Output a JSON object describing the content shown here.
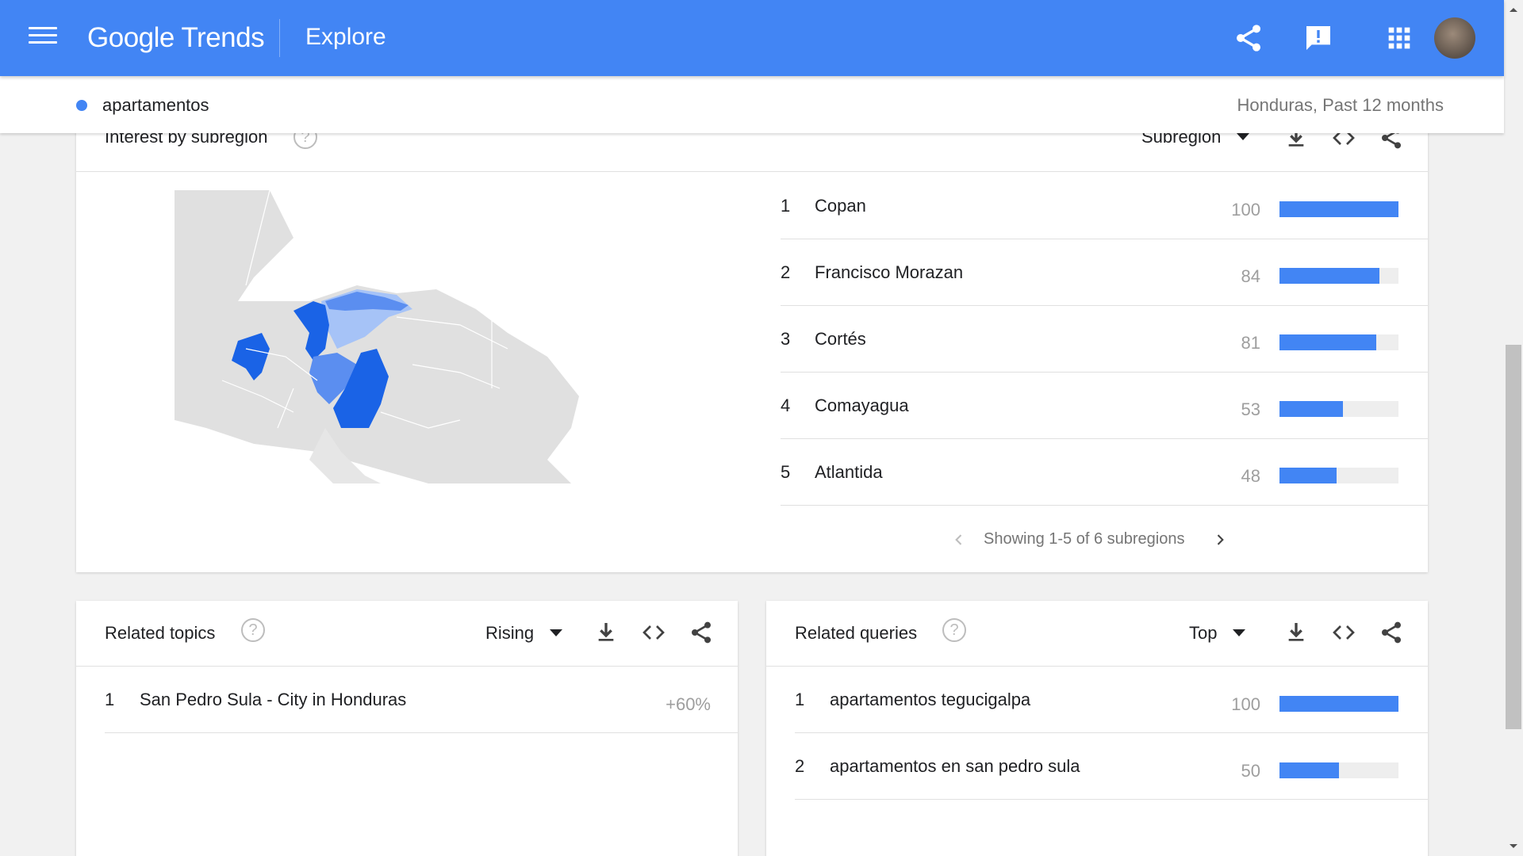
{
  "header": {
    "logo": "Google Trends",
    "section": "Explore",
    "icons": [
      "menu-icon",
      "share-icon",
      "feedback-icon",
      "apps-icon",
      "avatar"
    ]
  },
  "subheader": {
    "term": "apartamentos",
    "scope": "Honduras, Past 12 months"
  },
  "subregion": {
    "title": "Interest by subregion",
    "dropdown": "Subregion",
    "rows": [
      {
        "rank": "1",
        "label": "Copan",
        "value": "100",
        "fraction": 1.0
      },
      {
        "rank": "2",
        "label": "Francisco Morazan",
        "value": "84",
        "fraction": 0.84
      },
      {
        "rank": "3",
        "label": "Cortés",
        "value": "81",
        "fraction": 0.81
      },
      {
        "rank": "4",
        "label": "Comayagua",
        "value": "53",
        "fraction": 0.53
      },
      {
        "rank": "5",
        "label": "Atlantida",
        "value": "48",
        "fraction": 0.48
      }
    ],
    "pager": "Showing 1-5 of 6 subregions"
  },
  "related_topics": {
    "title": "Related topics",
    "dropdown": "Rising",
    "rows": [
      {
        "rank": "1",
        "label": "San Pedro Sula - City in Honduras",
        "value": "+60%"
      }
    ]
  },
  "related_queries": {
    "title": "Related queries",
    "dropdown": "Top",
    "rows": [
      {
        "rank": "1",
        "label": "apartamentos tegucigalpa",
        "value": "100",
        "fraction": 1.0
      },
      {
        "rank": "2",
        "label": "apartamentos en san pedro sula",
        "value": "50",
        "fraction": 0.5
      }
    ]
  },
  "colors": {
    "brand_blue": "#4285f4",
    "map_dark": "#1a63e6",
    "map_mid": "#5b8ef0",
    "map_light": "#a6c3f7",
    "map_base": "#e0e0e0"
  }
}
